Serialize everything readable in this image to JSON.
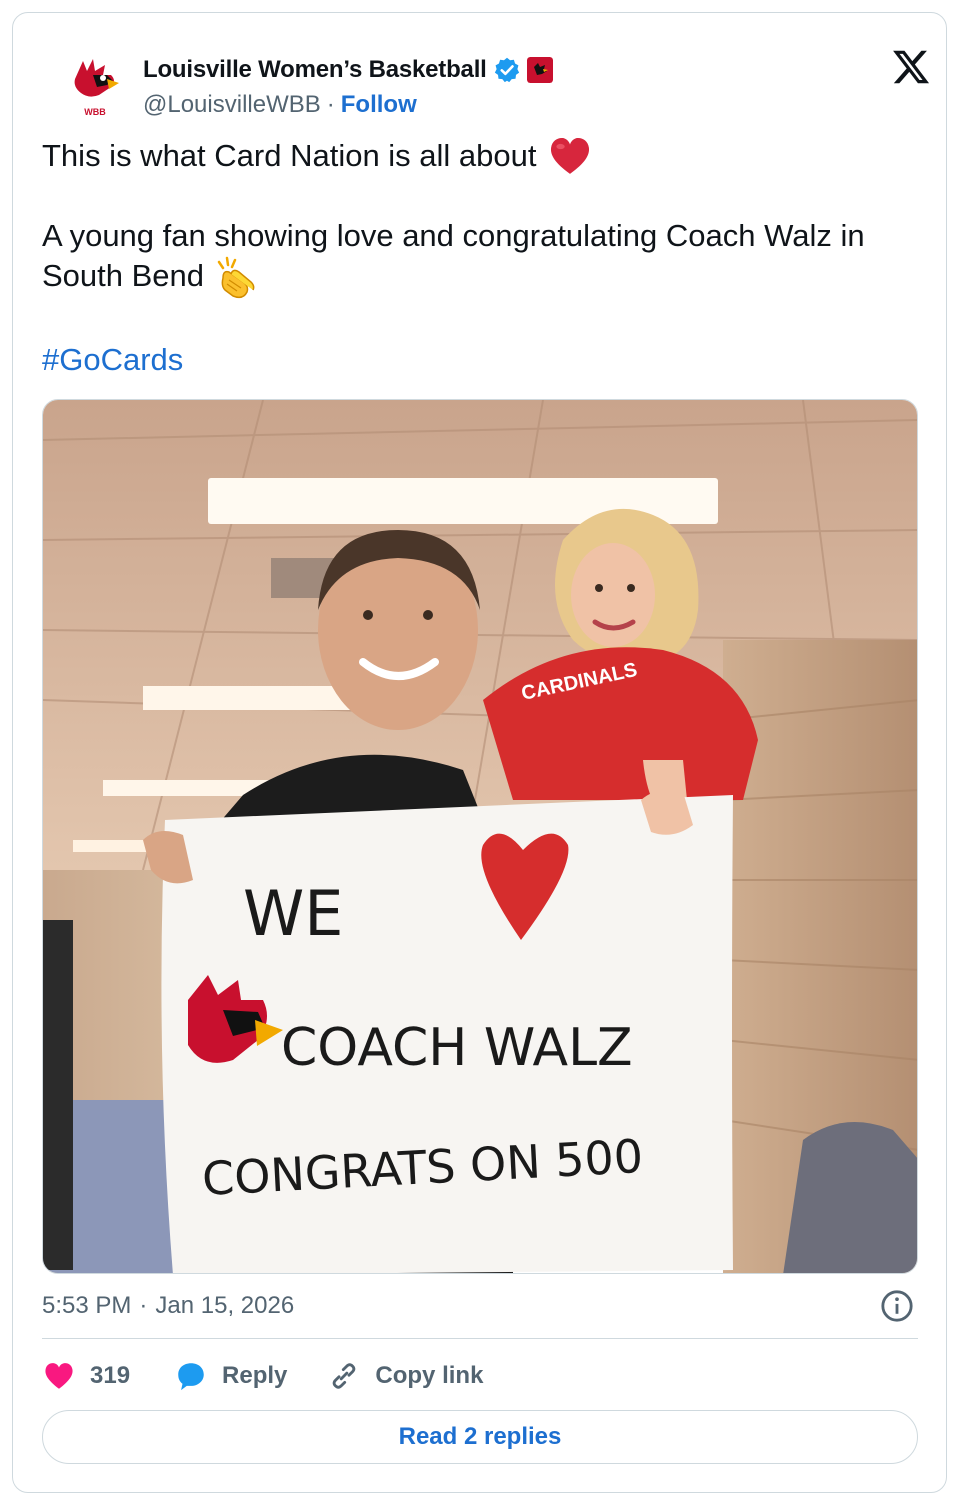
{
  "author": {
    "display_name": "Louisville Women’s Basketball",
    "handle": "@LouisvilleWBB",
    "separator": "·",
    "follow_label": "Follow",
    "avatar_text": "WBB",
    "verified_color": "#1d9bf0",
    "affiliate_badge_color": "#c8102e"
  },
  "tweet": {
    "line1": "This is what Card Nation is all about",
    "line1_emoji": "red-heart",
    "line2": "A young fan showing love and congratulating Coach Walz in South Bend",
    "line2_emoji": "clapping-hands",
    "hashtag": "#GoCards"
  },
  "media": {
    "sign_lines": [
      "WE",
      "COACH WALZ",
      "CONGRATS ON 500"
    ],
    "shirt_text": "CARDINALS"
  },
  "meta": {
    "time": "5:53 PM",
    "separator": "·",
    "date": "Jan 15, 2026"
  },
  "actions": {
    "like_count": "319",
    "reply_label": "Reply",
    "copy_link_label": "Copy link",
    "read_replies_label": "Read 2 replies"
  },
  "colors": {
    "accent": "#1d6fd0",
    "like": "#f91880",
    "reply_icon": "#1d9bf0",
    "secondary_text": "#536471",
    "border": "#cfd9de"
  }
}
